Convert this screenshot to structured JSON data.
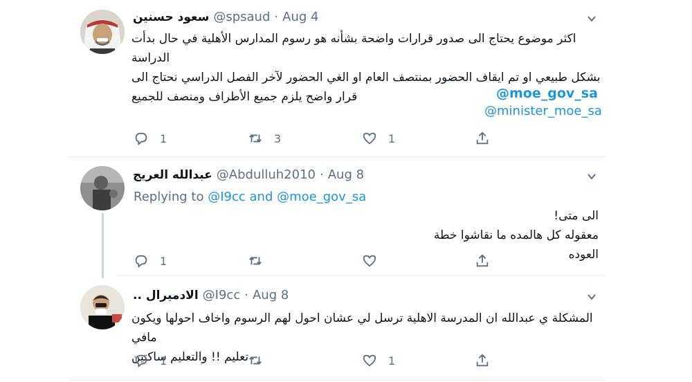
{
  "tweets": [
    {
      "display_name": "سعود حسنين",
      "handle": "@spsaud",
      "separator": "·",
      "date": "Aug 4",
      "text_lines": [
        "اكثر موضوع يحتاج الى صدور قرارات واضحة بشأنه هو رسوم المدارس الأهلية في حال بدأت الدراسة",
        "بشكل طبيعي او تم ايقاف الحضور بمنتصف العام او الغي الحضور لآخر الفصل الدراسي نحتاج الى",
        "قرار واضح يلزم جميع الأطراف ومنصف للجميع"
      ],
      "mentions": [
        "@moe_gov_sa",
        "@minister_moe_sa"
      ],
      "reply_count": "1",
      "retweet_count": "3",
      "like_count": "1"
    },
    {
      "display_name": "عبدالله العريج",
      "handle": "@Abdulluh2010",
      "separator": "·",
      "date": "Aug 8",
      "replying_prefix": "Replying to",
      "replying_user1": "@I9cc",
      "replying_and": "and",
      "replying_user2": "@moe_gov_sa",
      "text_lines": [
        "الى متى!",
        "معقوله كل هالمده ما نقاشوا خطة العوده"
      ],
      "reply_count": "1",
      "retweet_count": "",
      "like_count": ""
    },
    {
      "display_name": "الادميرال ..",
      "handle": "@I9cc",
      "separator": "·",
      "date": "Aug 8",
      "text_lines": [
        "المشكلة ي عبدالله ان المدرسة الاهلية ترسل لي عشان احول لهم الرسوم واخاف احولها ويكون مافي",
        "تعليم !! والتعليم ساكتين"
      ],
      "reply_count": "1",
      "retweet_count": "",
      "like_count": "1"
    }
  ],
  "icons": {
    "reply": "reply-icon",
    "retweet": "retweet-icon",
    "like": "heart-icon",
    "share": "share-icon",
    "caret": "chevron-down-icon"
  },
  "colors": {
    "link": "#1b95e0",
    "muted": "#5b7083",
    "divider": "#e6ecf0"
  }
}
